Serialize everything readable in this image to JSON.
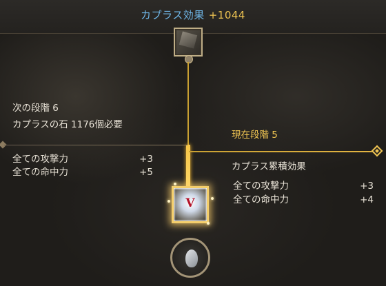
{
  "header": {
    "label": "カプラス効果",
    "value": "+1044"
  },
  "next_stage": {
    "title": "次の段階 6",
    "requirement": "カプラスの石 1176個必要",
    "stats": [
      {
        "name": "全ての攻撃力",
        "value": "+3"
      },
      {
        "name": "全ての命中力",
        "value": "+5"
      }
    ]
  },
  "current_stage": {
    "title": "現在段階 5",
    "effect_title": "カプラス累積効果",
    "stats": [
      {
        "name": "全ての攻撃力",
        "value": "+3"
      },
      {
        "name": "全ての命中力",
        "value": "+4"
      }
    ]
  },
  "active_node": {
    "mark": "V"
  },
  "colors": {
    "header_label": "#6fb7e8",
    "gold": "#f0c552",
    "text": "#e8e2d6"
  }
}
